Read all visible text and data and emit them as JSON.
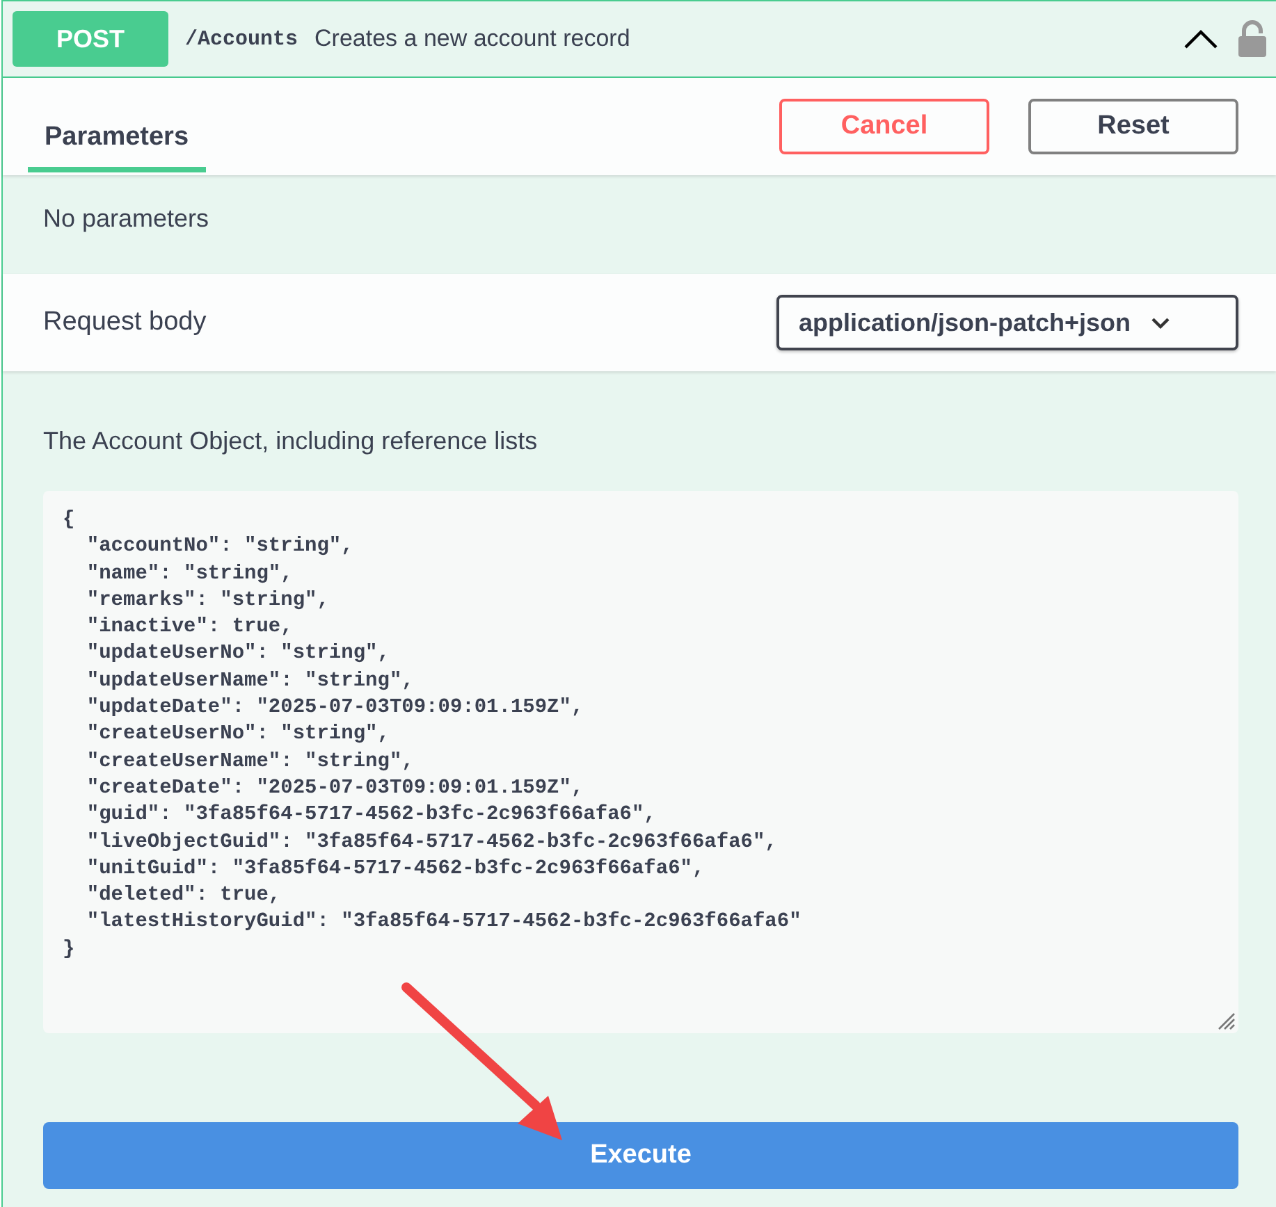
{
  "operation": {
    "method": "POST",
    "path": "/Accounts",
    "summary": "Creates a new account record",
    "expanded": true,
    "locked": false
  },
  "tabs": [
    {
      "label": "Parameters",
      "selected": true
    }
  ],
  "actions": [
    {
      "label": "Cancel",
      "kind": "cancel"
    },
    {
      "label": "Reset",
      "kind": "reset"
    }
  ],
  "parameters": {
    "empty_text": "No parameters"
  },
  "request_body": {
    "label": "Request body",
    "content_type": "application/json-patch+json",
    "description": "The Account Object, including reference lists",
    "lines": [
      "{",
      "  \"accountNo\": \"string\",",
      "  \"name\": \"string\",",
      "  \"remarks\": \"string\",",
      "  \"inactive\": true,",
      "  \"updateUserNo\": \"string\",",
      "  \"updateUserName\": \"string\",",
      "  \"updateDate\": \"2025-07-03T09:09:01.159Z\",",
      "  \"createUserNo\": \"string\",",
      "  \"createUserName\": \"string\",",
      "  \"createDate\": \"2025-07-03T09:09:01.159Z\",",
      "  \"guid\": \"3fa85f64-5717-4562-b3fc-2c963f66afa6\",",
      "  \"liveObjectGuid\": \"3fa85f64-5717-4562-b3fc-2c963f66afa6\",",
      "  \"unitGuid\": \"3fa85f64-5717-4562-b3fc-2c963f66afa6\",",
      "  \"deleted\": true,",
      "  \"latestHistoryGuid\": \"3fa85f64-5717-4562-b3fc-2c963f66afa6\"",
      "}"
    ]
  },
  "execute": {
    "label": "Execute"
  }
}
